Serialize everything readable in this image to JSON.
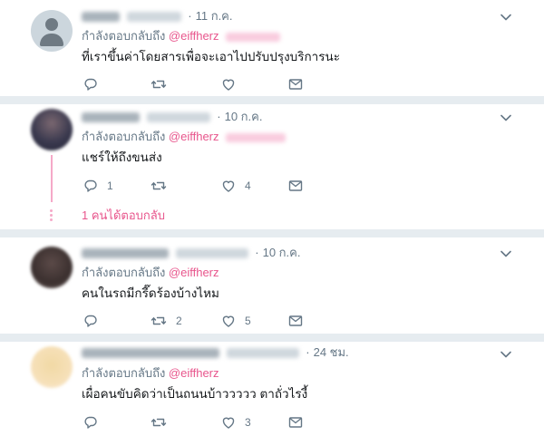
{
  "colors": {
    "accent": "#e0245e",
    "thread": "#f5a9c8",
    "separator": "#e6ecf0",
    "muted": "#657786"
  },
  "tweets": [
    {
      "date": "11 ก.ค.",
      "reply_prefix": "กำลังตอบกลับถึง",
      "mention": "@eiffherz",
      "text": "ที่เราขึ้นค่าโดยสารเพื่อจะเอาไปปรับปรุงบริการนะ",
      "reply_count": "",
      "retweet_count": "",
      "like_count": ""
    },
    {
      "date": "10 ก.ค.",
      "reply_prefix": "กำลังตอบกลับถึง",
      "mention": "@eiffherz",
      "text": "แชร์ให้ถึงขนส่ง",
      "reply_count": "1",
      "retweet_count": "",
      "like_count": "4",
      "more_replies": "1 คนได้ตอบกลับ"
    },
    {
      "date": "10 ก.ค.",
      "reply_prefix": "กำลังตอบกลับถึง",
      "mention": "@eiffherz",
      "text": "คนในรถมีกรี๊ดร้องบ้างไหม",
      "reply_count": "",
      "retweet_count": "2",
      "like_count": "5"
    },
    {
      "date": "24 ชม.",
      "reply_prefix": "กำลังตอบกลับถึง",
      "mention": "@eiffherz",
      "text": "เผื่อคนขับคิดว่าเป็นถนนบ้าววววว ตาถั่วไรงี้",
      "reply_count": "",
      "retweet_count": "",
      "like_count": "3"
    }
  ],
  "icons": {
    "reply": "reply-icon",
    "retweet": "retweet-icon",
    "like": "heart-icon",
    "dm": "envelope-icon",
    "menu": "chevron-down-icon"
  }
}
